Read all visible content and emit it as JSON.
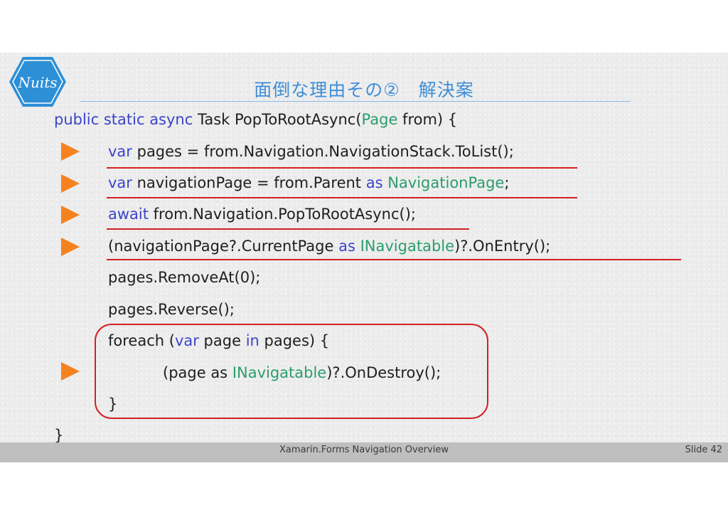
{
  "slide": {
    "title": "面倒な理由その②　解決案",
    "logo_text": "Nuits",
    "footer": "Xamarin.Forms Navigation Overview",
    "slide_number": "Slide 42"
  },
  "code": {
    "line1": {
      "t1": "public static async",
      "t2": " Task PopToRootAsync(",
      "t3": "Page",
      "t4": " from) {"
    },
    "line2": {
      "t1": "var",
      "t2": " pages = from.Navigation.NavigationStack.ToList();"
    },
    "line3": {
      "t1": "var",
      "t2": " navigationPage = from.Parent ",
      "t3": "as",
      "t4": " ",
      "t5": "NavigationPage",
      "t6": ";"
    },
    "line4": {
      "t1": "await",
      "t2": " from.Navigation.PopToRootAsync();"
    },
    "line5": {
      "t1": "(navigationPage?.CurrentPage ",
      "t2": "as",
      "t3": " ",
      "t4": "INavigatable",
      "t5": ")?.OnEntry();"
    },
    "line6": "pages.RemoveAt(0);",
    "line7": "pages.Reverse();",
    "line8": {
      "t1": "foreach (",
      "t2": "var",
      "t3": " page ",
      "t4": "in",
      "t5": " pages) {"
    },
    "line9": {
      "t1": "(page as ",
      "t2": "INavigatable",
      "t3": ")?.OnDestroy();"
    },
    "line10": "}",
    "line11": "}"
  },
  "colors": {
    "keyword": "#3b45c9",
    "type": "#2a9d6e",
    "arrow": "#f58220",
    "annotation": "#d32020",
    "title": "#3e8ed7"
  }
}
